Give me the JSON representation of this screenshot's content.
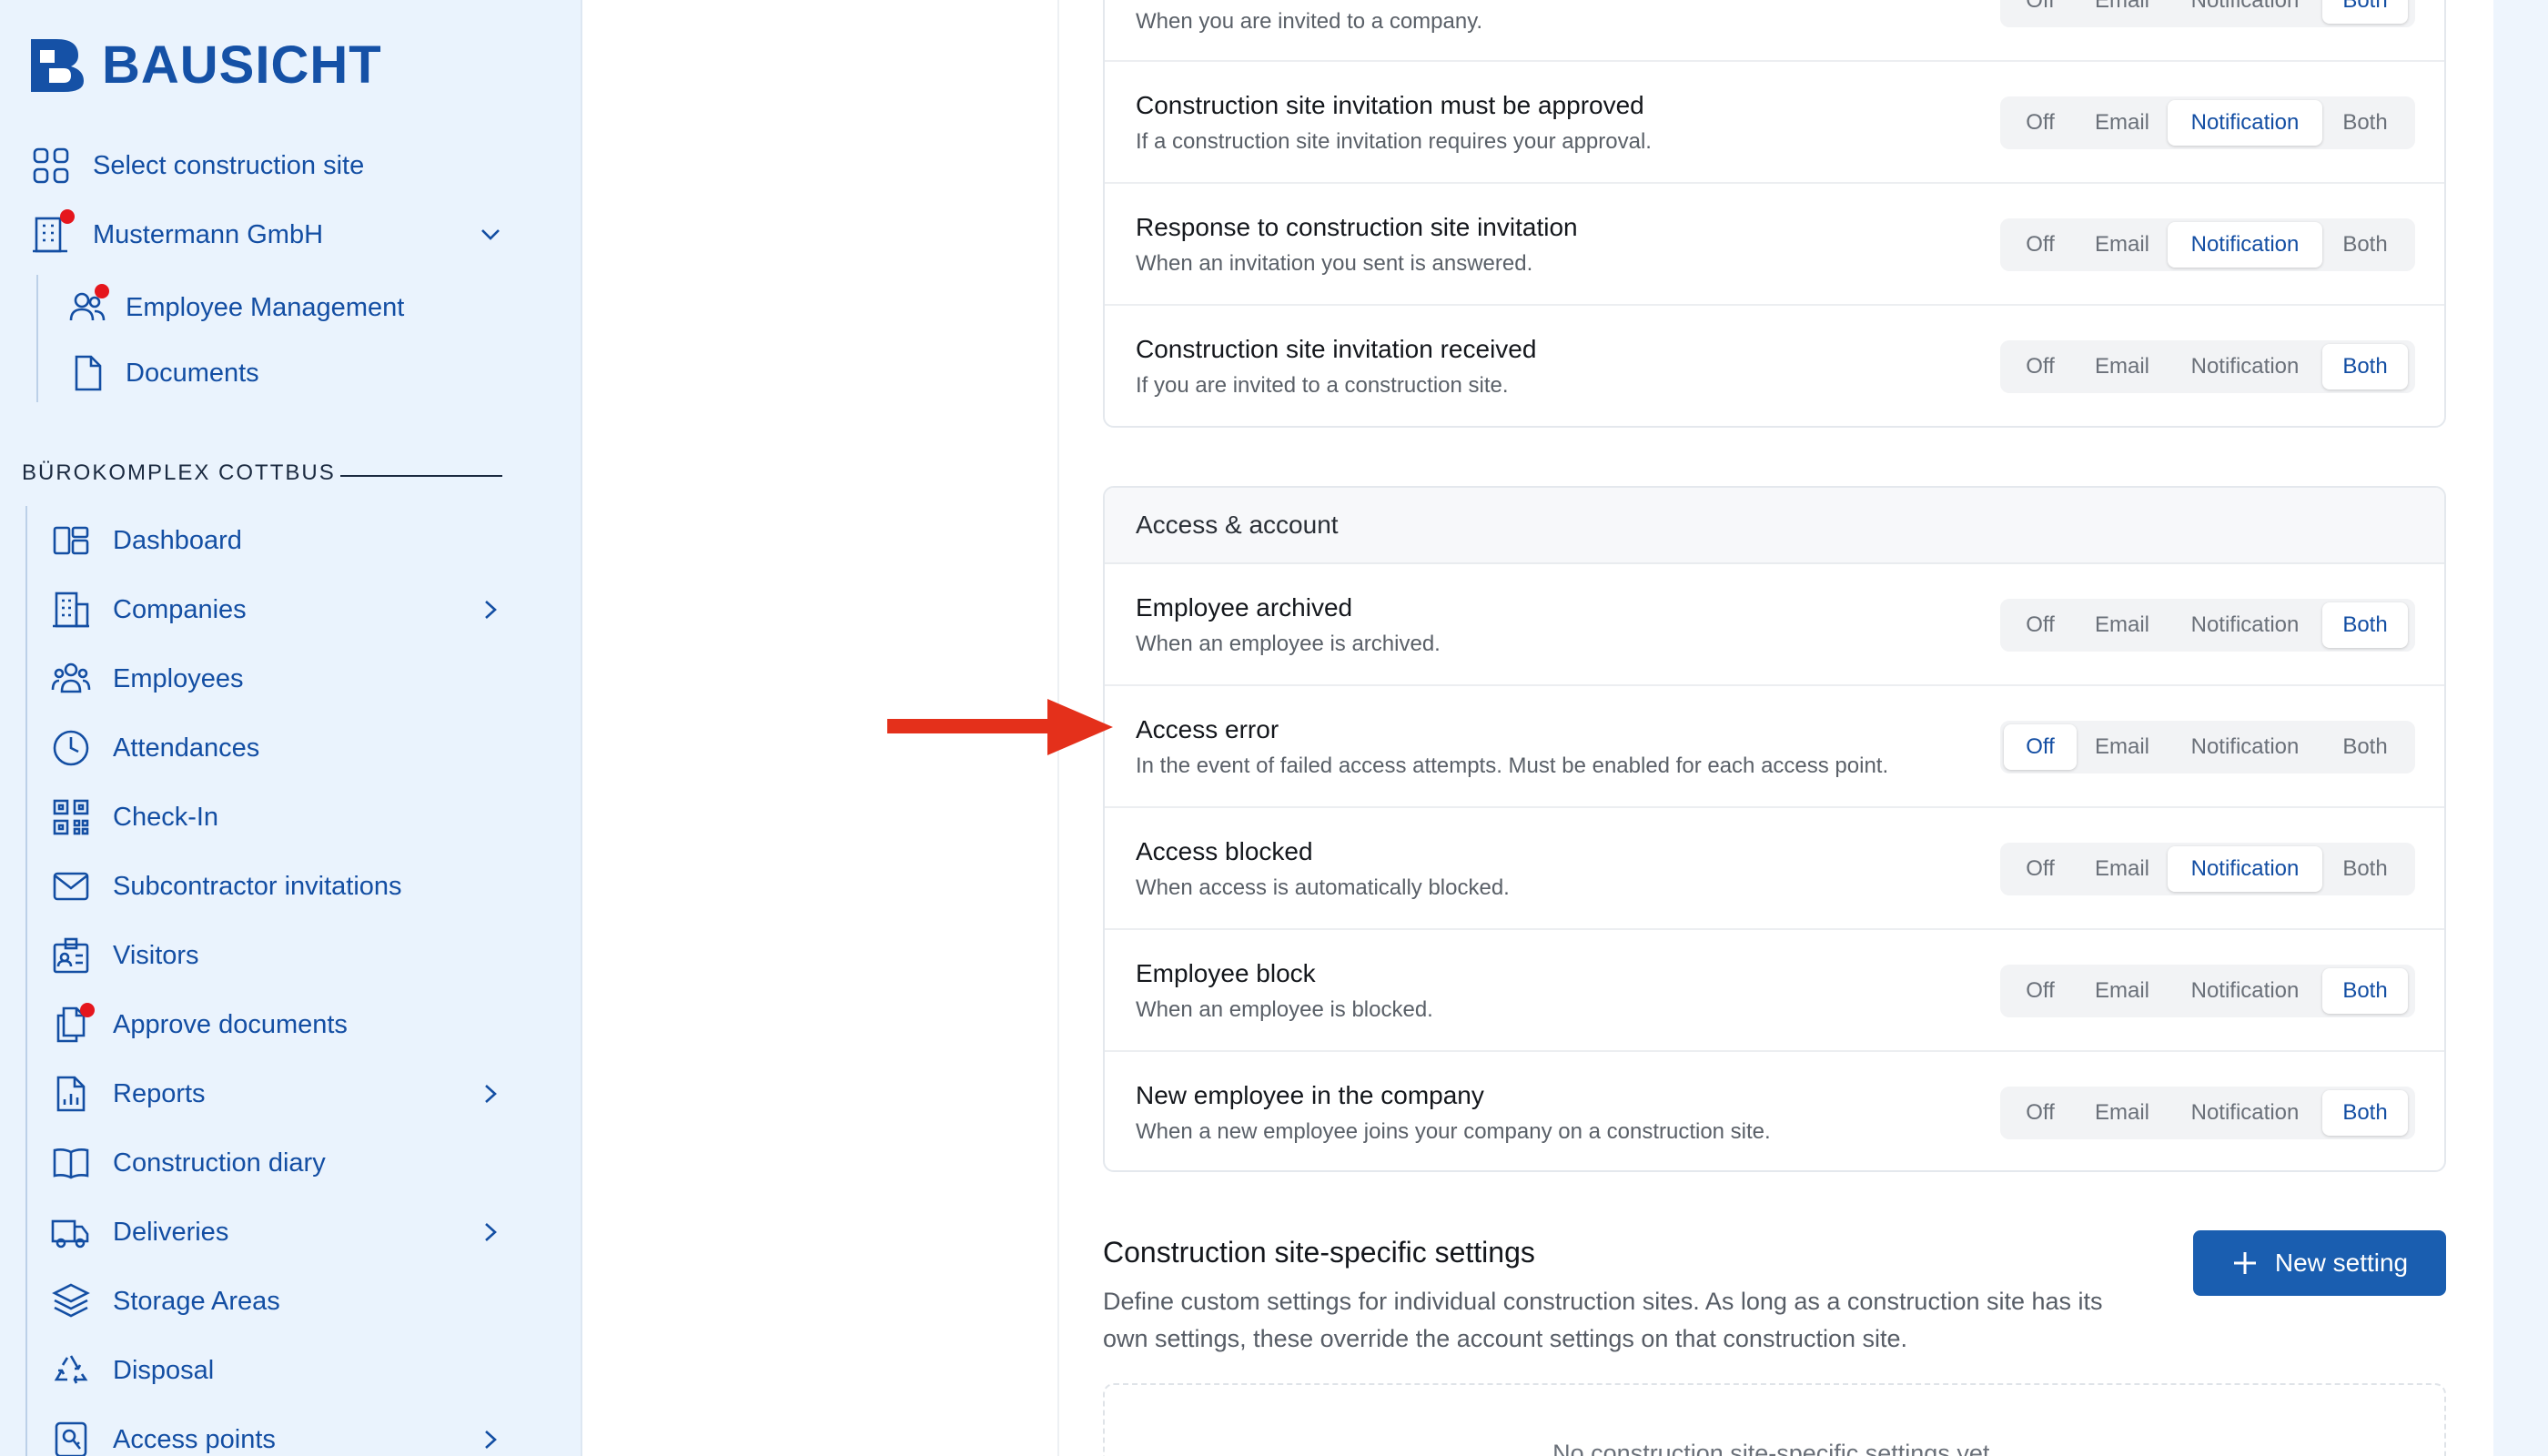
{
  "brand": {
    "name": "BAUSICHT",
    "accent": "#1551a6"
  },
  "sidebar": {
    "select_site": "Select construction site",
    "company": "Mustermann GmbH",
    "company_items": [
      "Employee Management",
      "Documents"
    ],
    "section_label": "BÜROKOMPLEX COTTBUS",
    "items": [
      {
        "label": "Dashboard",
        "icon": "dashboard-icon"
      },
      {
        "label": "Companies",
        "icon": "building-icon"
      },
      {
        "label": "Employees",
        "icon": "users-icon"
      },
      {
        "label": "Attendances",
        "icon": "clock-icon"
      },
      {
        "label": "Check-In",
        "icon": "qr-code-icon"
      },
      {
        "label": "Subcontractor invitations",
        "icon": "envelope-icon"
      },
      {
        "label": "Visitors",
        "icon": "id-badge-icon"
      },
      {
        "label": "Approve documents",
        "icon": "documents-icon"
      },
      {
        "label": "Reports",
        "icon": "report-icon"
      },
      {
        "label": "Construction diary",
        "icon": "book-icon"
      },
      {
        "label": "Deliveries",
        "icon": "truck-icon"
      },
      {
        "label": "Storage Areas",
        "icon": "layers-icon"
      },
      {
        "label": "Disposal",
        "icon": "recycle-icon"
      },
      {
        "label": "Access points",
        "icon": "access-point-icon"
      }
    ]
  },
  "options": [
    "Off",
    "Email",
    "Notification",
    "Both"
  ],
  "card1": {
    "rows": [
      {
        "title": "",
        "desc": "When you are invited to a company.",
        "selected": "Both"
      },
      {
        "title": "Construction site invitation must be approved",
        "desc": "If a construction site invitation requires your approval.",
        "selected": "Notification"
      },
      {
        "title": "Response to construction site invitation",
        "desc": "When an invitation you sent is answered.",
        "selected": "Notification"
      },
      {
        "title": "Construction site invitation received",
        "desc": "If you are invited to a construction site.",
        "selected": "Both"
      }
    ]
  },
  "card2": {
    "header": "Access & account",
    "rows": [
      {
        "title": "Employee archived",
        "desc": "When an employee is archived.",
        "selected": "Both"
      },
      {
        "title": "Access error",
        "desc": "In the event of failed access attempts. Must be enabled for each access point.",
        "selected": "Off"
      },
      {
        "title": "Access blocked",
        "desc": "When access is automatically blocked.",
        "selected": "Notification"
      },
      {
        "title": "Employee block",
        "desc": "When an employee is blocked.",
        "selected": "Both"
      },
      {
        "title": "New employee in the company",
        "desc": "When a new employee joins your company on a construction site.",
        "selected": "Both"
      }
    ]
  },
  "site_settings": {
    "title": "Construction site-specific settings",
    "desc": "Define custom settings for individual construction sites. As long as a construction site has its own settings, these override the account settings on that construction site.",
    "button": "New setting",
    "empty_text": "No construction site-specific settings yet."
  }
}
